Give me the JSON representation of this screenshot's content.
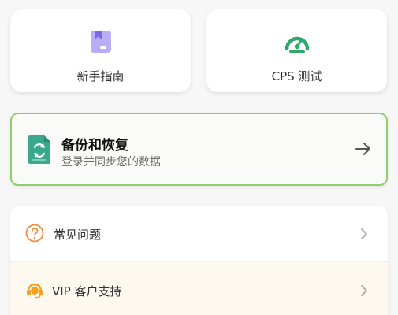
{
  "tiles": {
    "guide": {
      "label": "新手指南",
      "icon": "guide-book-icon",
      "color": "#9b8cf0"
    },
    "cps": {
      "label": "CPS 测试",
      "icon": "speedometer-icon",
      "color": "#2fa86a"
    }
  },
  "backup": {
    "title": "备份和恢复",
    "subtitle": "登录并同步您的数据",
    "icon": "backup-restore-file-icon",
    "accent": "#8fcf6a"
  },
  "list": {
    "items": [
      {
        "label": "常见问题",
        "icon": "question-circle-icon"
      },
      {
        "label": "VIP 客户支持",
        "icon": "headset-support-icon"
      }
    ]
  }
}
